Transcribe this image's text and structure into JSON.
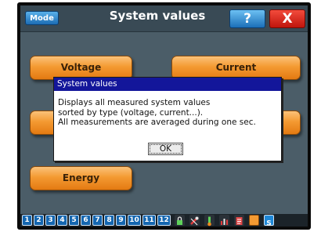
{
  "titlebar": {
    "mode_label": "Mode",
    "title": "System values",
    "help_label": "?",
    "close_label": "X"
  },
  "categories": [
    {
      "label": "Voltage"
    },
    {
      "label": "Current"
    },
    {
      "label": ""
    },
    {
      "label": ""
    },
    {
      "label": "Energy"
    }
  ],
  "dialog": {
    "title": "System values",
    "lines": [
      "Displays all measured system values",
      "sorted by type (voltage, current...).",
      "All measurements are averaged during one sec."
    ],
    "ok_label": "OK"
  },
  "bottombar": {
    "page_numbers": [
      "1",
      "2",
      "3",
      "4",
      "5",
      "6",
      "7",
      "8",
      "9",
      "10",
      "11",
      "12"
    ],
    "icons": [
      "lock-icon",
      "wrench-icon",
      "thermometer-icon",
      "chart-icon",
      "report-icon",
      "orange-square-icon",
      "settings-icon"
    ],
    "colors": {
      "page_button": "#1466b0",
      "accent": "#f49a32"
    }
  }
}
